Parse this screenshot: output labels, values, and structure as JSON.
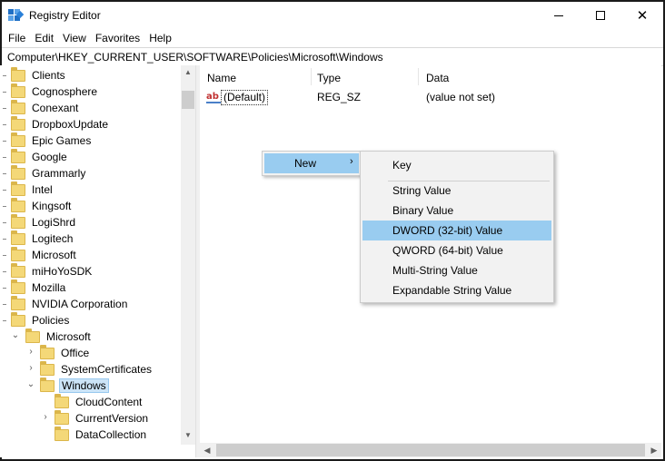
{
  "window": {
    "title": "Registry Editor",
    "minimize_glyph": "",
    "maximize_glyph": "",
    "close_glyph": "✕"
  },
  "menu": [
    "File",
    "Edit",
    "View",
    "Favorites",
    "Help"
  ],
  "address": "Computer\\HKEY_CURRENT_USER\\SOFTWARE\\Policies\\Microsoft\\Windows",
  "tree": {
    "items": [
      {
        "label": "Clients",
        "level": 0
      },
      {
        "label": "Cognosphere",
        "level": 0
      },
      {
        "label": "Conexant",
        "level": 0
      },
      {
        "label": "DropboxUpdate",
        "level": 0
      },
      {
        "label": "Epic Games",
        "level": 0
      },
      {
        "label": "Google",
        "level": 0
      },
      {
        "label": "Grammarly",
        "level": 0
      },
      {
        "label": "Intel",
        "level": 0
      },
      {
        "label": "Kingsoft",
        "level": 0
      },
      {
        "label": "LogiShrd",
        "level": 0
      },
      {
        "label": "Logitech",
        "level": 0
      },
      {
        "label": "Microsoft",
        "level": 0
      },
      {
        "label": "miHoYoSDK",
        "level": 0
      },
      {
        "label": "Mozilla",
        "level": 0
      },
      {
        "label": "NVIDIA Corporation",
        "level": 0
      },
      {
        "label": "Policies",
        "level": 0
      },
      {
        "label": "Microsoft",
        "level": 1
      },
      {
        "label": "Office",
        "level": 2
      },
      {
        "label": "SystemCertificates",
        "level": 2
      },
      {
        "label": "Windows",
        "level": 2
      },
      {
        "label": "CloudContent",
        "level": 3
      },
      {
        "label": "CurrentVersion",
        "level": 3
      },
      {
        "label": "DataCollection",
        "level": 3
      }
    ]
  },
  "list": {
    "columns": [
      "Name",
      "Type",
      "Data"
    ],
    "rows": [
      {
        "name": "(Default)",
        "type": "REG_SZ",
        "data": "(value not set)",
        "icon": "ab-string-icon"
      }
    ]
  },
  "context_menu": {
    "new_label": "New",
    "new_arrow": "›",
    "submenu": [
      "Key",
      "String Value",
      "Binary Value",
      "DWORD (32-bit) Value",
      "QWORD (64-bit) Value",
      "Multi-String Value",
      "Expandable String Value"
    ],
    "highlighted": "DWORD (32-bit) Value"
  },
  "icons": {
    "ab_icon_text": "ab"
  },
  "colors": {
    "highlight": "#99ccf0",
    "folder": "#f4d878",
    "selection": "#cce4f7"
  }
}
